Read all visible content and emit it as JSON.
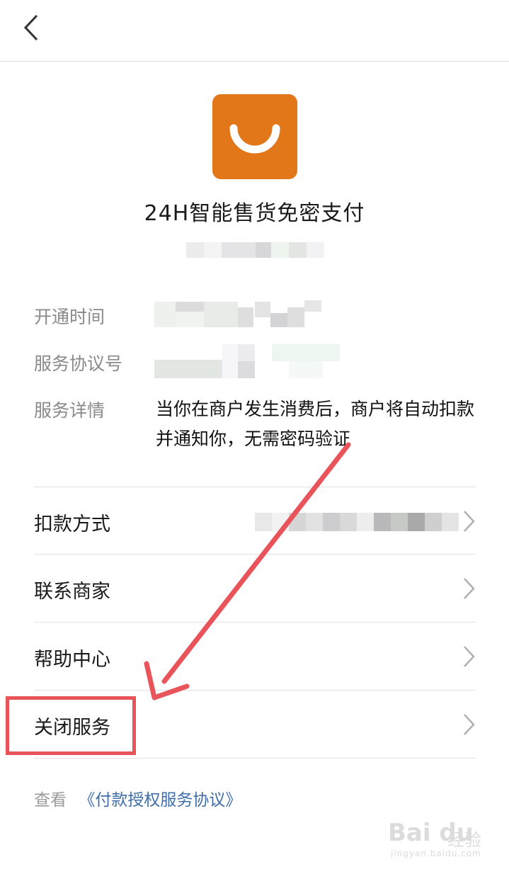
{
  "header": {
    "back_icon": "chevron-left-icon"
  },
  "app": {
    "title": "24H智能售货免密支付",
    "logo_color": "#e2771a",
    "logo_icon": "smile-arc-icon"
  },
  "info": {
    "open_time_label": "开通时间",
    "agreement_no_label": "服务协议号",
    "details_label": "服务详情",
    "details_text": "当你在商户发生消费后，商户将自动扣款并通知你，无需密码验证"
  },
  "menu": {
    "items": [
      {
        "label": "扣款方式"
      },
      {
        "label": "联系商家"
      },
      {
        "label": "帮助中心"
      },
      {
        "label": "关闭服务"
      }
    ]
  },
  "footer": {
    "prefix": "查看",
    "link": "《付款授权服务协议》"
  },
  "annotation": {
    "color": "#e8545a"
  },
  "watermark": {
    "logo": "Bai du",
    "jy": "经验",
    "url": "jingyan.baidu.com"
  }
}
